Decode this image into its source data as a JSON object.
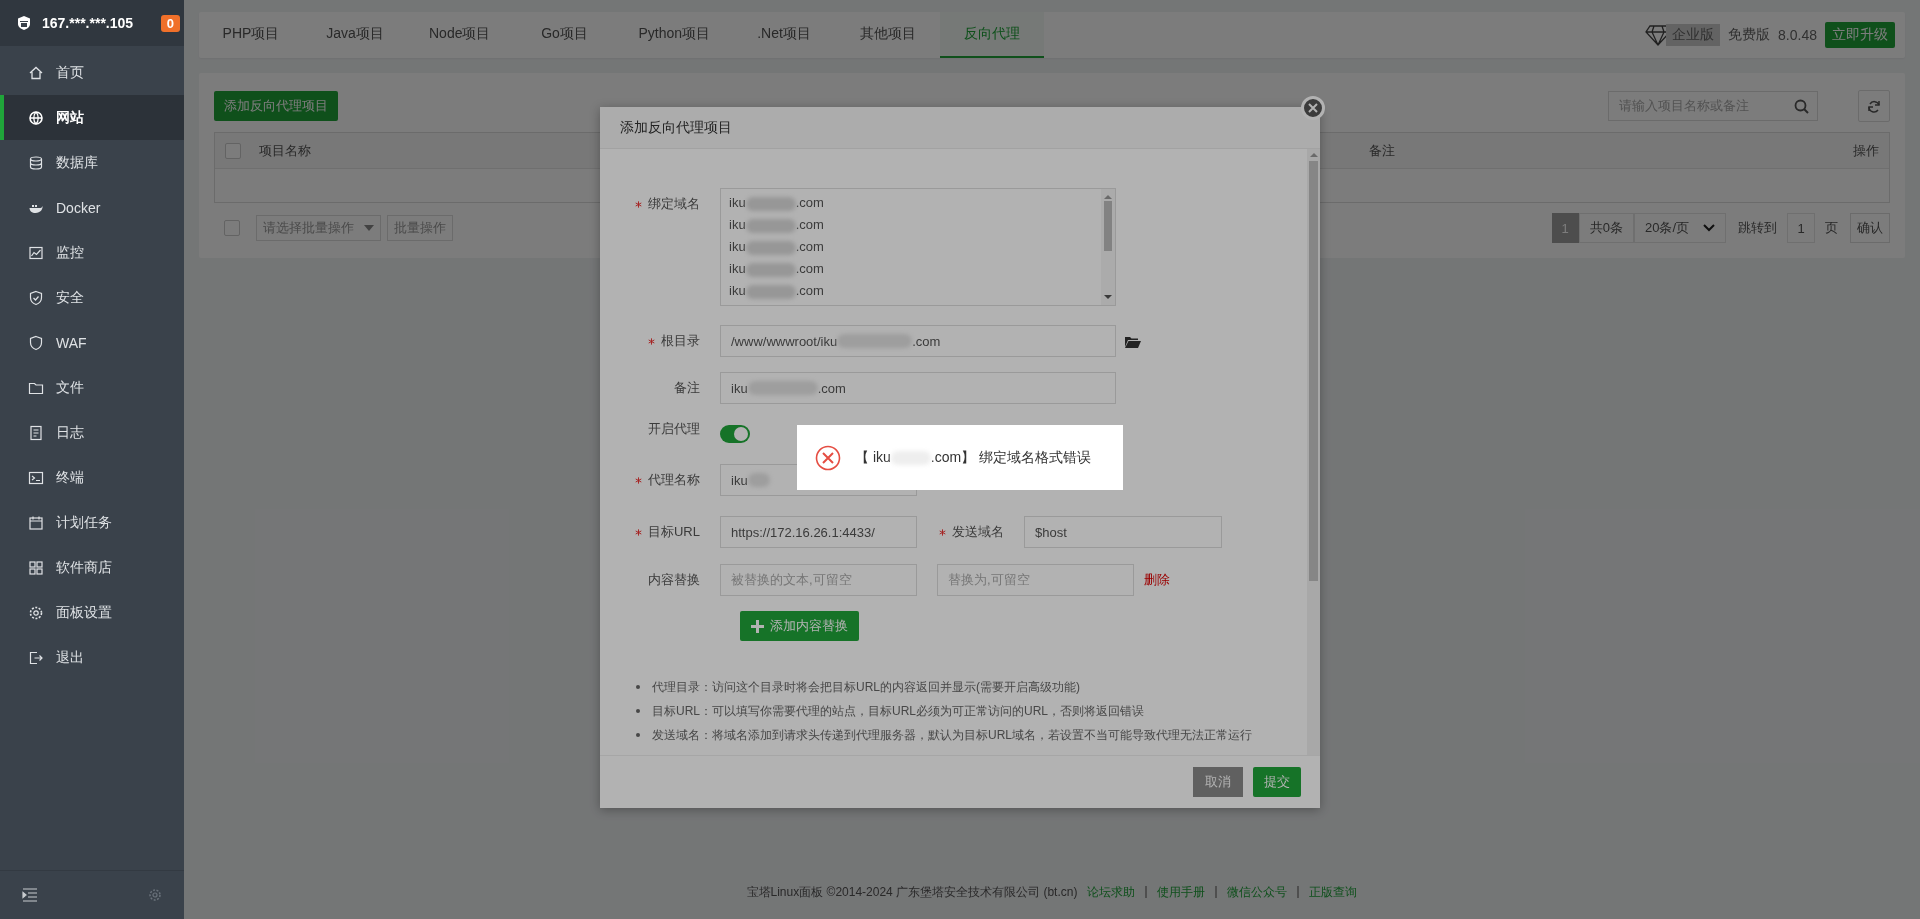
{
  "sidebar": {
    "server": "167.***.***.105",
    "badge": "0",
    "items": [
      {
        "label": "首页",
        "selected": false
      },
      {
        "label": "网站",
        "selected": true
      },
      {
        "label": "数据库",
        "selected": false
      },
      {
        "label": "Docker",
        "selected": false
      },
      {
        "label": "监控",
        "selected": false
      },
      {
        "label": "安全",
        "selected": false
      },
      {
        "label": "WAF",
        "selected": false
      },
      {
        "label": "文件",
        "selected": false
      },
      {
        "label": "日志",
        "selected": false
      },
      {
        "label": "终端",
        "selected": false
      },
      {
        "label": "计划任务",
        "selected": false
      },
      {
        "label": "软件商店",
        "selected": false
      },
      {
        "label": "面板设置",
        "selected": false
      },
      {
        "label": "退出",
        "selected": false
      }
    ]
  },
  "tabs": [
    {
      "label": "PHP项目",
      "selected": false
    },
    {
      "label": "Java项目",
      "selected": false
    },
    {
      "label": "Node项目",
      "selected": false
    },
    {
      "label": "Go项目",
      "selected": false
    },
    {
      "label": "Python项目",
      "selected": false
    },
    {
      "label": ".Net项目",
      "selected": false
    },
    {
      "label": "其他项目",
      "selected": false
    },
    {
      "label": "反向代理",
      "selected": true
    }
  ],
  "edition": {
    "enterprise": "企业版",
    "free": "免费版",
    "version": "8.0.48",
    "upgrade": "立即升级"
  },
  "toolbar": {
    "add_button": "添加反向代理项目",
    "search": {
      "placeholder": "请输入项目名称或备注"
    }
  },
  "table": {
    "select_all": {
      "checked": false
    },
    "columns": [
      "项目名称",
      "备注",
      "操作"
    ],
    "batch": {
      "checked": false,
      "placeholder": "请选择批量操作",
      "button": "批量操作"
    }
  },
  "pagination": {
    "page": "1",
    "total": "共0条",
    "page_size": "20条/页",
    "jump_label": "跳转到",
    "jump_value": "1",
    "page_unit": "页",
    "confirm": "确认"
  },
  "dialog": {
    "title": "添加反向代理项目",
    "domains": {
      "label": "绑定域名",
      "required": true,
      "lines": [
        {
          "start": "iku",
          "end": ".com"
        },
        {
          "start": "iku",
          "end": ".com"
        },
        {
          "start": "iku",
          "end": ".com"
        },
        {
          "start": "iku",
          "end": ".com"
        },
        {
          "start": "iku",
          "end": ".com"
        }
      ]
    },
    "root": {
      "label": "根目录",
      "required": true,
      "start": "/www/wwwroot/iku",
      "end": ".com"
    },
    "remark": {
      "label": "备注",
      "required": false,
      "start": "iku",
      "end": ".com"
    },
    "proxy_switch": {
      "label": "开启代理",
      "on": true
    },
    "proxy_name": {
      "label": "代理名称",
      "required": true,
      "start": "iku"
    },
    "target_url": {
      "label": "目标URL",
      "required": true,
      "value": "https://172.16.26.1:4433/"
    },
    "send_domain": {
      "label": "发送域名",
      "required": true,
      "value": "$host"
    },
    "replace": {
      "label": "内容替换",
      "required": false,
      "from_placeholder": "被替换的文本,可留空",
      "to_placeholder": "替换为,可留空",
      "delete": "删除"
    },
    "add_replace": "添加内容替换",
    "notes": [
      "代理目录：访问这个目录时将会把目标URL的内容返回并显示(需要开启高级功能)",
      "目标URL：可以填写你需要代理的站点，目标URL必须为可正常访问的URL，否则将返回错误",
      "发送域名：将域名添加到请求头传递到代理服务器，默认为目标URL域名，若设置不当可能导致代理无法正常运行"
    ],
    "cancel": "取消",
    "submit": "提交"
  },
  "toast": {
    "start": "【 iku",
    "end": ".com】 绑定域名格式错误"
  },
  "footer": {
    "copyright": "宝塔Linux面板 ©2014-2024 广东堡塔安全技术有限公司 (bt.cn)",
    "links": [
      "论坛求助",
      "使用手册",
      "微信公众号",
      "正版查询"
    ]
  }
}
